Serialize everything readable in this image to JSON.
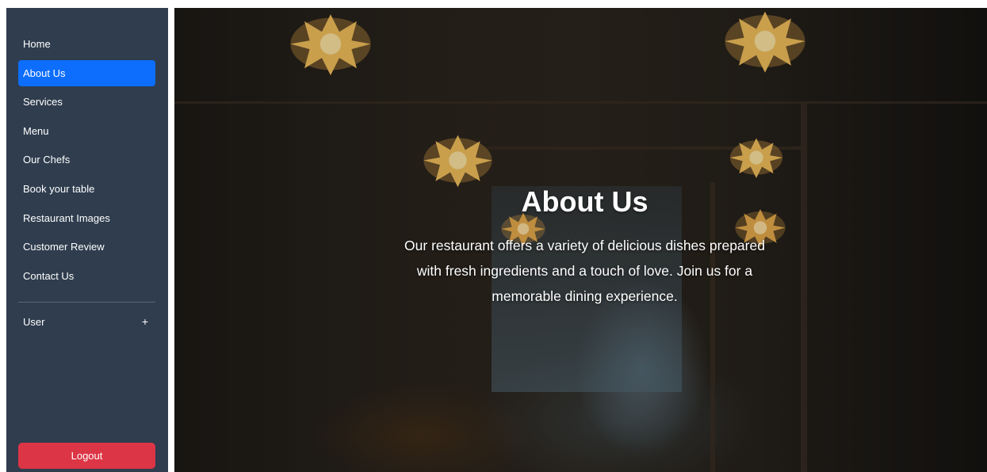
{
  "sidebar": {
    "items": [
      {
        "label": "Home"
      },
      {
        "label": "About Us",
        "active": true
      },
      {
        "label": "Services"
      },
      {
        "label": "Menu"
      },
      {
        "label": "Our Chefs"
      },
      {
        "label": "Book your table"
      },
      {
        "label": "Restaurant Images"
      },
      {
        "label": "Customer Review"
      },
      {
        "label": "Contact Us"
      }
    ],
    "user_label": "User",
    "user_toggle": "+",
    "logout_label": "Logout",
    "active_color": "#0d6efd",
    "logout_color": "#dc3545",
    "background_color": "#2f3d4e"
  },
  "hero": {
    "title": "About Us",
    "description": "Our restaurant offers a variety of delicious dishes prepared with fresh ingredients and a touch of love. Join us for a memorable dining experience.",
    "background_icon": "restaurant-interior-photo"
  }
}
